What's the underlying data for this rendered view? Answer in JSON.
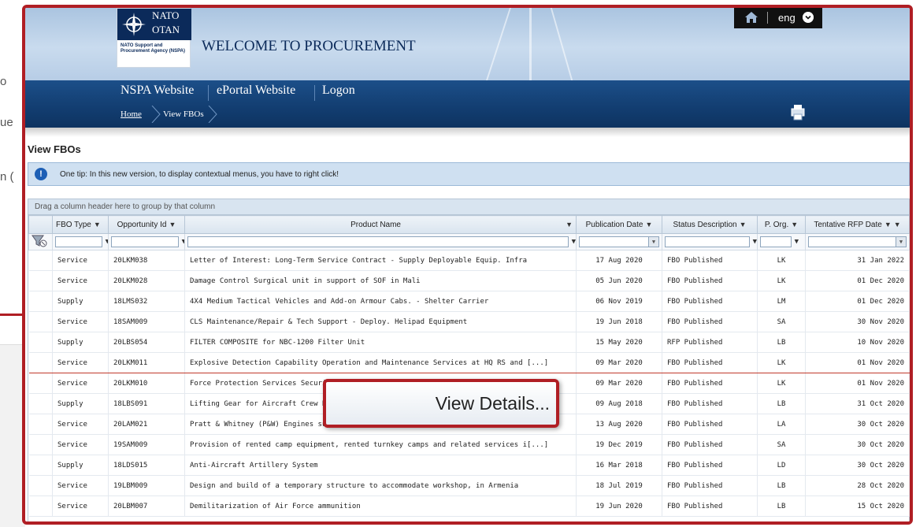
{
  "background": {
    "fragments": [
      "o",
      "ue",
      "n ("
    ]
  },
  "header": {
    "logo_line1": "NATO",
    "logo_line2": "OTAN",
    "logo_agency": "NATO Support and Procurement Agency (NSPA)",
    "welcome": "WELCOME TO PROCUREMENT",
    "language": "eng",
    "home_icon": "home-icon",
    "lang_icon": "chevron-down-icon"
  },
  "nav": {
    "items": [
      "NSPA Website",
      "ePortal Website",
      "Logon"
    ],
    "breadcrumb_home": "Home",
    "breadcrumb_current": "View FBOs",
    "print_icon": "print-icon"
  },
  "page": {
    "title": "View FBOs",
    "tip": "One tip: In this new version, to display contextual menus, you have to right click!",
    "group_hint": "Drag a column header here to group by that column"
  },
  "grid": {
    "columns": [
      "FBO Type",
      "Opportunity Id",
      "Product Name",
      "Publication Date",
      "Status Description",
      "P. Org.",
      "Tentative RFP Date"
    ],
    "rows": [
      [
        "Service",
        "20LKM038",
        "Letter of Interest: Long-Term Service Contract - Supply Deployable Equip. Infra",
        "17 Aug 2020",
        "FBO Published",
        "LK",
        "31 Jan 2022"
      ],
      [
        "Service",
        "20LKM028",
        "Damage Control Surgical unit in support of SOF in Mali",
        "05 Jun 2020",
        "FBO Published",
        "LK",
        "01 Dec 2020"
      ],
      [
        "Supply",
        "18LMS032",
        "4X4 Medium Tactical Vehicles and Add-on Armour Cabs. - Shelter Carrier",
        "06 Nov 2019",
        "FBO Published",
        "LM",
        "01 Dec 2020"
      ],
      [
        "Service",
        "18SAM009",
        "CLS Maintenance/Repair & Tech Support - Deploy. Helipad Equipment",
        "19 Jun 2018",
        "FBO Published",
        "SA",
        "30 Nov 2020"
      ],
      [
        "Supply",
        "20LBS054",
        "FILTER COMPOSITE for NBC-1200 Filter Unit",
        "15 May 2020",
        "RFP Published",
        "LB",
        "10 Nov 2020"
      ],
      [
        "Service",
        "20LKM011",
        "Explosive Detection Capability Operation and Maintenance Services at HQ RS and [...]",
        "09 Mar 2020",
        "FBO Published",
        "LK",
        "01 Nov 2020"
      ],
      [
        "Service",
        "20LKM010",
        "Force Protection Services Security",
        "09 Mar 2020",
        "FBO Published",
        "LK",
        "01 Nov 2020"
      ],
      [
        "Supply",
        "18LBS091",
        "Lifting Gear for Aircraft Crew Rec",
        "09 Aug 2018",
        "FBO Published",
        "LB",
        "31 Oct 2020"
      ],
      [
        "Service",
        "20LAM021",
        "Pratt & Whitney (P&W) Engines suppo",
        "13 Aug 2020",
        "FBO Published",
        "LA",
        "30 Oct 2020"
      ],
      [
        "Service",
        "19SAM009",
        "Provision of rented camp equipment, rented turnkey camps and related services i[...]",
        "19 Dec 2019",
        "FBO Published",
        "SA",
        "30 Oct 2020"
      ],
      [
        "Supply",
        "18LDS015",
        "Anti-Aircraft Artillery System",
        "16 Mar 2018",
        "FBO Published",
        "LD",
        "30 Oct 2020"
      ],
      [
        "Service",
        "19LBM009",
        "Design and build of a temporary structure to accommodate workshop, in Armenia",
        "18 Jul 2019",
        "FBO Published",
        "LB",
        "28 Oct 2020"
      ],
      [
        "Service",
        "20LBM007",
        "Demilitarization of Air Force ammunition",
        "19 Jun 2020",
        "FBO Published",
        "LB",
        "15 Oct 2020"
      ]
    ]
  },
  "context_menu": {
    "label": "View Details..."
  },
  "colors": {
    "highlight": "#b01e24",
    "nav": "#123d70",
    "banner": "#c9dbee"
  }
}
